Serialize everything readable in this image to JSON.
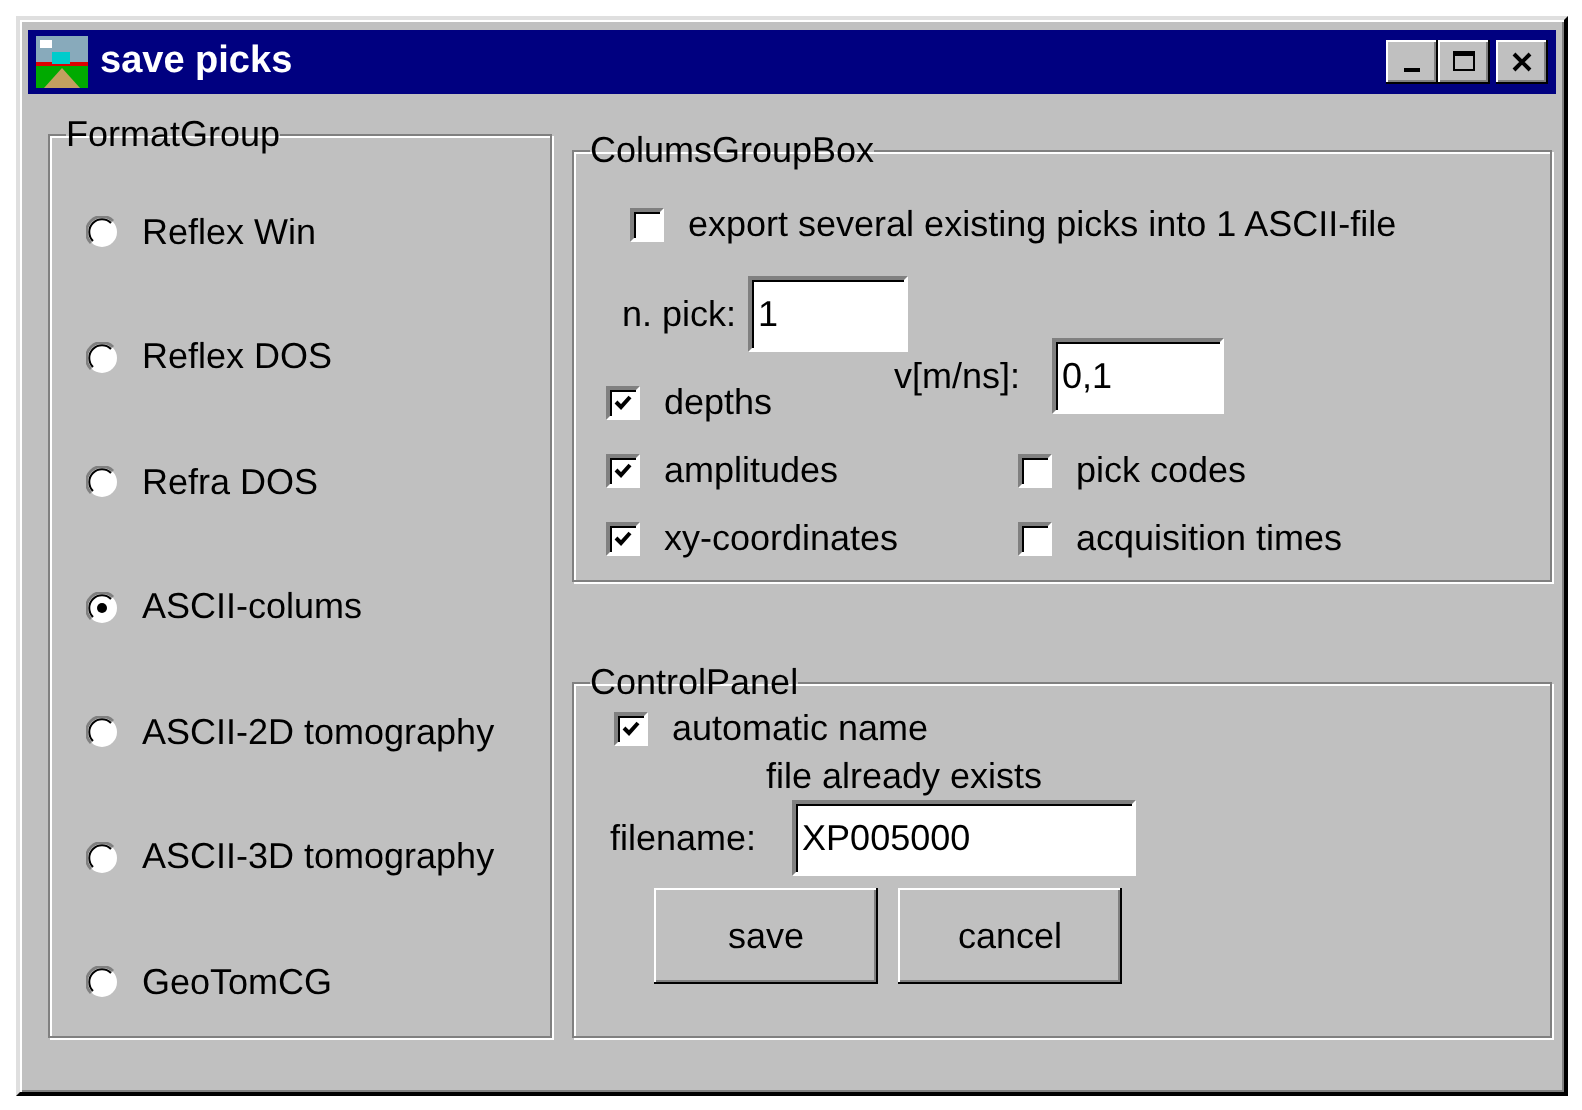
{
  "window": {
    "title": "save picks"
  },
  "format_group": {
    "title": "FormatGroup",
    "options": [
      {
        "label": "Reflex Win",
        "selected": false
      },
      {
        "label": "Reflex DOS",
        "selected": false
      },
      {
        "label": "Refra DOS",
        "selected": false
      },
      {
        "label": "ASCII-colums",
        "selected": true
      },
      {
        "label": "ASCII-2D tomography",
        "selected": false
      },
      {
        "label": "ASCII-3D tomography",
        "selected": false
      },
      {
        "label": "GeoTomCG",
        "selected": false
      }
    ]
  },
  "columns_group": {
    "title": "ColumsGroupBox",
    "export_several": {
      "label": "export several existing picks into 1 ASCII-file",
      "checked": false
    },
    "n_pick": {
      "label": "n. pick:",
      "value": "1"
    },
    "velocity": {
      "label": "v[m/ns]:",
      "value": "0,1"
    },
    "columns": [
      {
        "label": "depths",
        "checked": true
      },
      {
        "label": "amplitudes",
        "checked": true
      },
      {
        "label": "xy-coordinates",
        "checked": true
      }
    ],
    "extra_columns": [
      {
        "label": "pick codes",
        "checked": false
      },
      {
        "label": "acquisition times",
        "checked": false
      }
    ]
  },
  "control_panel": {
    "title": "ControlPanel",
    "automatic_name": {
      "label": "automatic name",
      "checked": true
    },
    "status": "file already exists",
    "filename": {
      "label": "filename:",
      "value": "XP005000"
    },
    "buttons": [
      "save",
      "cancel"
    ]
  }
}
